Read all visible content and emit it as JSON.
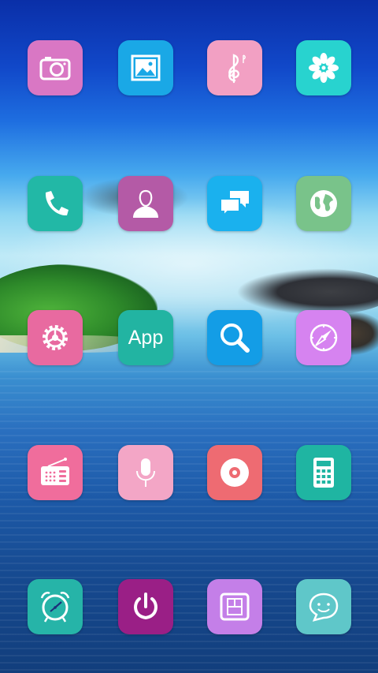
{
  "home_screen": {
    "apps": [
      {
        "icon": "camera-icon",
        "color": "#d977c4"
      },
      {
        "icon": "gallery-icon",
        "color": "#1aa8e6"
      },
      {
        "icon": "music-icon",
        "color": "#f2a0c3"
      },
      {
        "icon": "flower-settings-icon",
        "color": "#28d3cf"
      },
      {
        "icon": "phone-icon",
        "color": "#22b8a6"
      },
      {
        "icon": "contacts-icon",
        "color": "#b45aa6"
      },
      {
        "icon": "messages-icon",
        "color": "#1ab1ee"
      },
      {
        "icon": "globe-icon",
        "color": "#79c38a"
      },
      {
        "icon": "gear-icon",
        "color": "#e86aa0"
      },
      {
        "icon": "app-store-icon",
        "color": "#22b4a2",
        "label": "App"
      },
      {
        "icon": "search-icon",
        "color": "#139de6"
      },
      {
        "icon": "compass-icon",
        "color": "#d683f0"
      },
      {
        "icon": "radio-icon",
        "color": "#f06d9c"
      },
      {
        "icon": "microphone-icon",
        "color": "#f3a6c6"
      },
      {
        "icon": "record-icon",
        "color": "#ee6b72"
      },
      {
        "icon": "calculator-icon",
        "color": "#1fb5a2"
      },
      {
        "icon": "alarm-clock-icon",
        "color": "#26b4a8"
      },
      {
        "icon": "power-icon",
        "color": "#9a1f86"
      },
      {
        "icon": "sim-card-icon",
        "color": "#c47fe8"
      },
      {
        "icon": "chat-smile-icon",
        "color": "#5fc7c9"
      }
    ]
  }
}
